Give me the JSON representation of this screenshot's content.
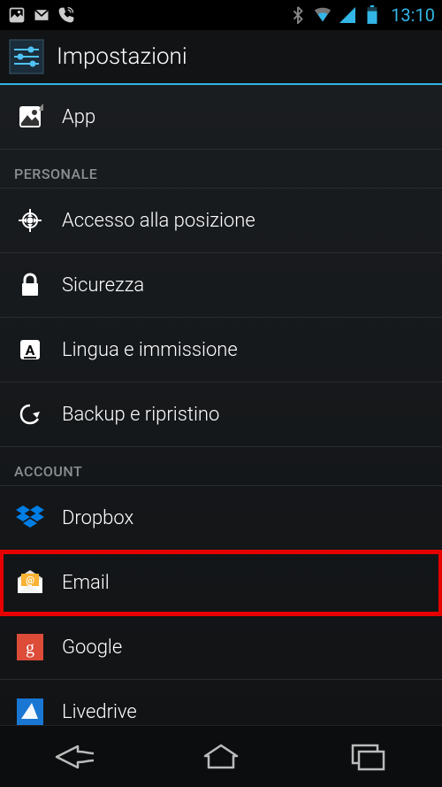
{
  "status_bar": {
    "time": "13:10"
  },
  "header": {
    "title": "Impostazioni"
  },
  "list": {
    "app": "App",
    "section_personal": "PERSONALE",
    "location": "Accesso alla posizione",
    "security": "Sicurezza",
    "language": "Lingua e immissione",
    "backup": "Backup e ripristino",
    "section_account": "ACCOUNT",
    "dropbox": "Dropbox",
    "email": "Email",
    "google": "Google",
    "livedrive": "Livedrive"
  }
}
